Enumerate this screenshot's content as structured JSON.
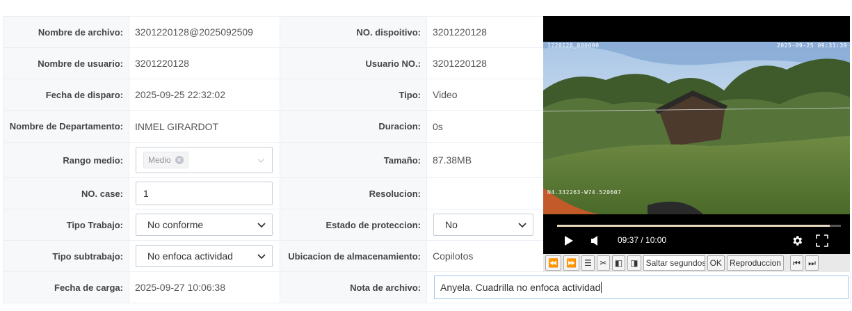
{
  "rows": [
    {
      "label": "Nombre de archivo:",
      "value": "3201220128@2025092509",
      "label2": "NO. dispoitivo:",
      "value2": "3201220128"
    },
    {
      "label": "Nombre de usuario:",
      "value": "3201220128",
      "label2": "Usuario NO.:",
      "value2": "3201220128"
    },
    {
      "label": "Fecha de disparo:",
      "value": "2025-09-25 22:32:02",
      "label2": "Tipo:",
      "value2": "Video"
    },
    {
      "label": "Nombre de Departamento:",
      "value": "INMEL GIRARDOT",
      "label2": "Duracion:",
      "value2": "0s"
    },
    {
      "label": "Rango medio:",
      "value": "Medio",
      "label2": "Tamaño:",
      "value2": "87.38MB"
    },
    {
      "label": "NO. case:",
      "value": "1",
      "label2": "Resolucion:",
      "value2": ""
    },
    {
      "label": "Tipo Trabajo:",
      "value": "No conforme",
      "label2": "Estado de proteccion:",
      "value2": "No"
    },
    {
      "label": "Tipo subtrabajo:",
      "value": "No enfoca actividad",
      "label2": "Ubicacion de almacenamiento:",
      "value2": "Copilotos"
    },
    {
      "label": "Fecha de carga:",
      "value": "2025-09-27 10:06:38",
      "label2": "Nota de archivo:",
      "value2": "Anyela. Cuadrilla no enfoca actividad"
    }
  ],
  "video": {
    "osd_top_left": "1220128_000000",
    "osd_top_right": "2025-09-25 09:31:39",
    "osd_gps": "N4.332263-W74.520607",
    "time_display": "09:37 / 10:00",
    "progress": 0.96
  },
  "toolbar": {
    "seek_placeholder": "Saltar segundos",
    "ok_label": "OK",
    "playback_label": "Reproduccion"
  },
  "colors": {
    "label_bg": "#f7f8fa",
    "border": "#ebeef5",
    "video_bg": "#000000",
    "progress": "#e6d6bf"
  }
}
